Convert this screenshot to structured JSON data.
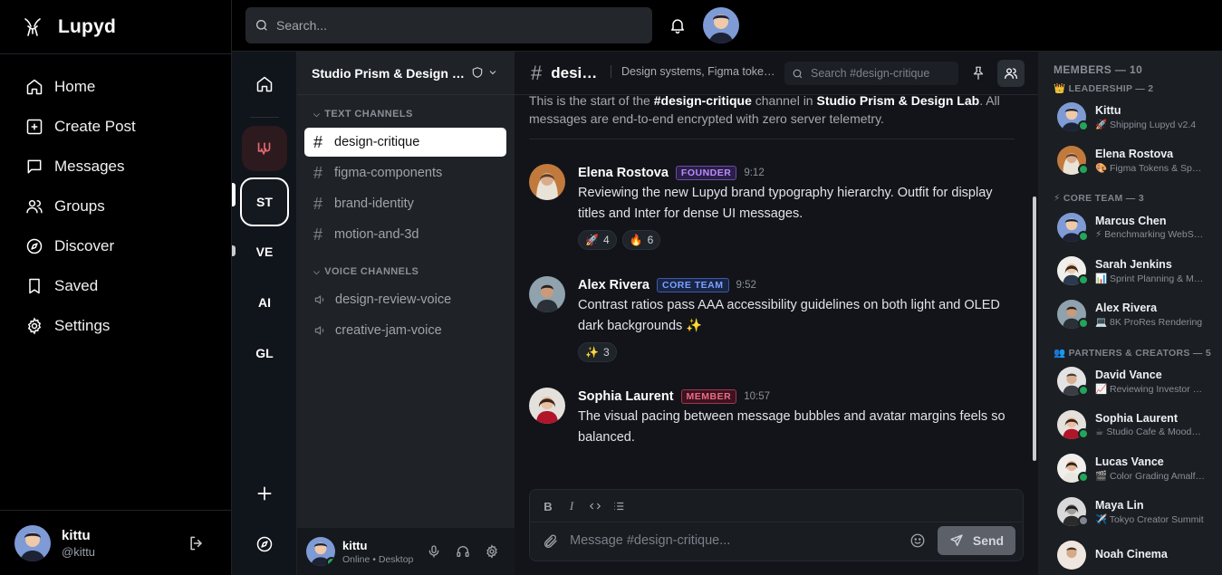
{
  "app": {
    "name": "Lupyd"
  },
  "nav": {
    "items": [
      {
        "label": "Home",
        "icon": "home-icon"
      },
      {
        "label": "Create Post",
        "icon": "plus-square-icon"
      },
      {
        "label": "Messages",
        "icon": "message-icon"
      },
      {
        "label": "Groups",
        "icon": "users-icon"
      },
      {
        "label": "Discover",
        "icon": "compass-icon"
      },
      {
        "label": "Saved",
        "icon": "bookmark-icon"
      },
      {
        "label": "Settings",
        "icon": "gear-icon"
      }
    ]
  },
  "current_user": {
    "name": "kittu",
    "handle": "@kittu",
    "status": "Online • Desktop"
  },
  "topbar": {
    "search_placeholder": "Search..."
  },
  "server_rail": {
    "servers": [
      "ST",
      "VE",
      "AI",
      "GL"
    ],
    "active": "ST"
  },
  "server": {
    "name": "Studio Prism & Design Lab"
  },
  "channels": {
    "text_category": "TEXT CHANNELS",
    "text": [
      "design-critique",
      "figma-components",
      "brand-identity",
      "motion-and-3d"
    ],
    "voice_category": "VOICE CHANNELS",
    "voice": [
      "design-review-voice",
      "creative-jam-voice"
    ],
    "active": "design-critique"
  },
  "chat": {
    "channel": "design-critique",
    "topic": "Design systems, Figma tokens, and UI critique",
    "search_placeholder": "Search #design-critique",
    "intro_prefix": "This is the start of the ",
    "intro_channel": "#design-critique",
    "intro_mid": " channel in ",
    "intro_server": "Studio Prism & Design Lab",
    "intro_suffix": ". All messages are end-to-end encrypted with zero server telemetry.",
    "messages": [
      {
        "author": "Elena Rostova",
        "badge": "FOUNDER",
        "badge_color": "#b98cff",
        "time": "9:12",
        "text": "Reviewing the new Lupyd brand typography hierarchy. Outfit for display titles and Inter for dense UI messages.",
        "reactions": [
          {
            "emoji": "🚀",
            "count": "4"
          },
          {
            "emoji": "🔥",
            "count": "6"
          }
        ]
      },
      {
        "author": "Alex Rivera",
        "badge": "CORE TEAM",
        "badge_color": "#7aa2ff",
        "time": "9:52",
        "text": "Contrast ratios pass AAA accessibility guidelines on both light and OLED dark backgrounds ✨",
        "reactions": [
          {
            "emoji": "✨",
            "count": "3"
          }
        ]
      },
      {
        "author": "Sophia Laurent",
        "badge": "MEMBER",
        "badge_color": "#f06a84",
        "time": "10:57",
        "text": "The visual pacing between message bubbles and avatar margins feels so balanced.",
        "reactions": []
      }
    ],
    "composer_placeholder": "Message #design-critique...",
    "send_label": "Send"
  },
  "members": {
    "header": "MEMBERS — 10",
    "groups": [
      {
        "label": "👑 LEADERSHIP — 2",
        "members": [
          {
            "name": "Kittu",
            "activity": "🚀 Shipping Lupyd v2.4",
            "status": "online"
          },
          {
            "name": "Elena Rostova",
            "activity": "🎨 Figma Tokens & Spacing",
            "status": "online"
          }
        ]
      },
      {
        "label": "⚡ CORE TEAM — 3",
        "members": [
          {
            "name": "Marcus Chen",
            "activity": "⚡ Benchmarking WebSockets",
            "status": "online"
          },
          {
            "name": "Sarah Jenkins",
            "activity": "📊 Sprint Planning & Metrics",
            "status": "online"
          },
          {
            "name": "Alex Rivera",
            "activity": "💻 8K ProRes Rendering",
            "status": "online"
          }
        ]
      },
      {
        "label": "👥 PARTNERS & CREATORS — 5",
        "members": [
          {
            "name": "David Vance",
            "activity": "📈 Reviewing Investor Deck",
            "status": "online"
          },
          {
            "name": "Sophia Laurent",
            "activity": "☕ Studio Cafe & Moodboards",
            "status": "online"
          },
          {
            "name": "Lucas Vance",
            "activity": "🎬 Color Grading Amalfi Coast",
            "status": "online"
          },
          {
            "name": "Maya Lin",
            "activity": "✈️ Tokyo Creator Summit",
            "status": "idle"
          },
          {
            "name": "Noah Cinema",
            "activity": "",
            "status": "online"
          }
        ]
      }
    ]
  },
  "colors": {
    "accent": "#ffffff",
    "online": "#23a55a",
    "idle": "#80848e"
  }
}
